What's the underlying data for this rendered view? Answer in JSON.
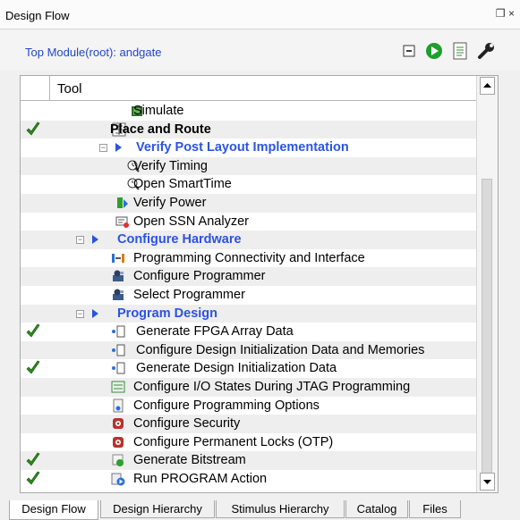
{
  "window": {
    "title": "Design Flow",
    "pin_glyph": "❒",
    "close_glyph": "×"
  },
  "header": {
    "top_module": "Top Module(root): andgate"
  },
  "grid": {
    "column_title": "Tool"
  },
  "rows": [
    {
      "label": "Simulate",
      "style": "normal",
      "check": false,
      "icon": "simulate-icon"
    },
    {
      "label": "Place and Route",
      "style": "bold",
      "check": true,
      "icon": "place-and-route-icon"
    },
    {
      "label": "Verify Post Layout Implementation",
      "style": "section",
      "check": false,
      "icon": ""
    },
    {
      "label": "Verify Timing",
      "style": "normal",
      "check": false,
      "icon": "verify-timing-icon"
    },
    {
      "label": "Open SmartTime",
      "style": "normal",
      "check": false,
      "icon": "smarttime-icon"
    },
    {
      "label": "Verify Power",
      "style": "normal",
      "check": false,
      "icon": "verify-power-icon"
    },
    {
      "label": "Open SSN Analyzer",
      "style": "normal",
      "check": false,
      "icon": "ssn-analyzer-icon"
    },
    {
      "label": "Configure Hardware",
      "style": "section",
      "check": false,
      "icon": ""
    },
    {
      "label": "Programming Connectivity and Interface",
      "style": "normal",
      "check": false,
      "icon": "connectivity-icon"
    },
    {
      "label": "Configure Programmer",
      "style": "normal",
      "check": false,
      "icon": "programmer-icon"
    },
    {
      "label": "Select Programmer",
      "style": "normal",
      "check": false,
      "icon": "programmer-icon"
    },
    {
      "label": "Program Design",
      "style": "section",
      "check": false,
      "icon": ""
    },
    {
      "label": "Generate FPGA Array Data",
      "style": "normal",
      "check": true,
      "icon": "data-icon"
    },
    {
      "label": "Configure Design Initialization Data and Memories",
      "style": "normal",
      "check": false,
      "icon": "data-icon"
    },
    {
      "label": "Generate Design Initialization Data",
      "style": "normal",
      "check": true,
      "icon": "data-icon"
    },
    {
      "label": "Configure I/O States During JTAG Programming",
      "style": "normal",
      "check": false,
      "icon": "io-states-icon"
    },
    {
      "label": "Configure Programming Options",
      "style": "normal",
      "check": false,
      "icon": "options-icon"
    },
    {
      "label": "Configure Security",
      "style": "normal",
      "check": false,
      "icon": "security-icon"
    },
    {
      "label": "Configure Permanent Locks (OTP)",
      "style": "normal",
      "check": false,
      "icon": "security-icon"
    },
    {
      "label": "Generate Bitstream",
      "style": "normal",
      "check": true,
      "icon": "bitstream-icon"
    },
    {
      "label": "Run PROGRAM Action",
      "style": "normal",
      "check": true,
      "icon": "run-program-icon"
    }
  ],
  "tabs": [
    {
      "label": "Design Flow",
      "active": true
    },
    {
      "label": "Design Hierarchy",
      "active": false
    },
    {
      "label": "Stimulus Hierarchy",
      "active": false
    },
    {
      "label": "Catalog",
      "active": false
    },
    {
      "label": "Files",
      "active": false
    }
  ],
  "colors": {
    "section_blue": "#2b54e0",
    "check_green": "#2f8a1c",
    "run_green": "#1e9e2e",
    "header_link": "#1f48c8"
  }
}
